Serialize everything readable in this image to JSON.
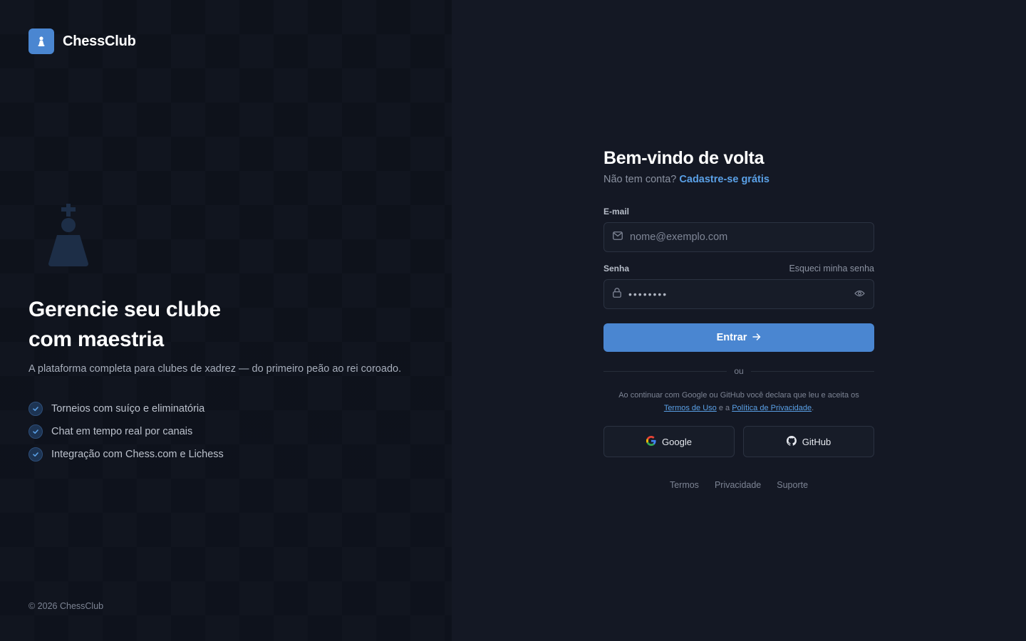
{
  "brand": {
    "name": "ChessClub"
  },
  "hero": {
    "title_line1": "Gerencie seu clube",
    "title_line2": "com maestria",
    "subtitle": "A plataforma completa para clubes de xadrez — do primeiro peão ao rei coroado.",
    "features": [
      "Torneios com suíço e eliminatória",
      "Chat em tempo real por canais",
      "Integração com Chess.com e Lichess"
    ]
  },
  "copyright": "© 2026 ChessClub",
  "login": {
    "title": "Bem-vindo de volta",
    "no_account": "Não tem conta?",
    "signup_link": "Cadastre-se grátis",
    "email_label": "E-mail",
    "email_placeholder": "nome@exemplo.com",
    "password_label": "Senha",
    "forgot_link": "Esqueci minha senha",
    "password_mask": "••••••••",
    "submit_label": "Entrar",
    "divider_text": "ou",
    "disclaimer_pre": "Ao continuar com Google ou GitHub você declara que leu e aceita os",
    "terms_link": "Termos de Uso",
    "disclaimer_mid": "e a",
    "privacy_link": "Política de Privacidade",
    "disclaimer_end": ".",
    "google_label": "Google",
    "github_label": "GitHub"
  },
  "footer": {
    "terms": "Termos",
    "privacy": "Privacidade",
    "support": "Suporte"
  },
  "colors": {
    "accent": "#4a86d1",
    "link": "#5aa0e6",
    "background": "#141824"
  }
}
